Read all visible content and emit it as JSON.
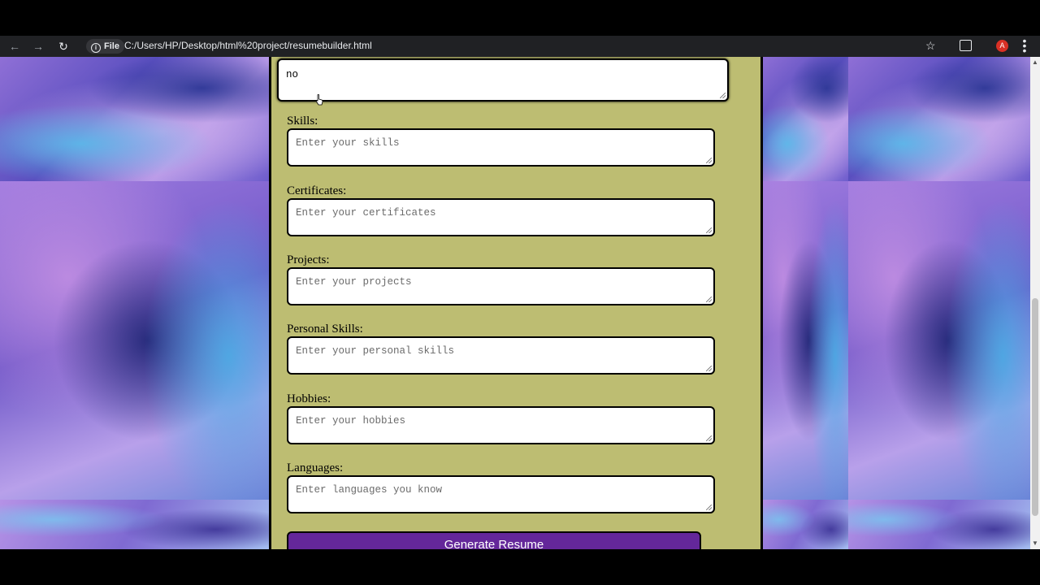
{
  "browser": {
    "back_icon": "←",
    "forward_icon": "→",
    "reload_icon": "↻",
    "site_chip": "File",
    "url": "C:/Users/HP/Desktop/html%20project/resumebuilder.html",
    "star_icon": "☆",
    "profile_initial": "A",
    "menu_icon": "⋮"
  },
  "form": {
    "current_field_value": "no",
    "fields": [
      {
        "label": "Skills:",
        "placeholder": "Enter your skills"
      },
      {
        "label": "Certificates:",
        "placeholder": "Enter your certificates"
      },
      {
        "label": "Projects:",
        "placeholder": "Enter your projects"
      },
      {
        "label": "Personal Skills:",
        "placeholder": "Enter your personal skills"
      },
      {
        "label": "Hobbies:",
        "placeholder": "Enter your hobbies"
      },
      {
        "label": "Languages:",
        "placeholder": "Enter languages you know"
      }
    ],
    "submit_label": "Generate Resume"
  },
  "colors": {
    "panel": "#bdbd72",
    "button": "#64279a",
    "chrome": "#202124"
  }
}
